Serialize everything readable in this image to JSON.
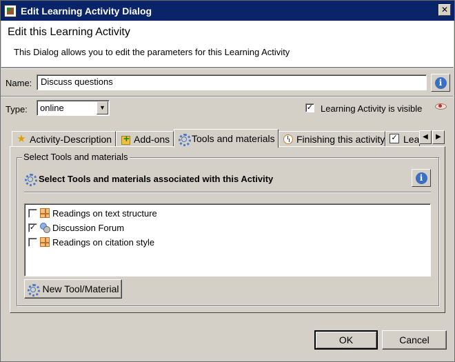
{
  "window": {
    "title": "Edit Learning Activity Dialog",
    "close_glyph": "✕"
  },
  "header": {
    "title": "Edit this Learning Activity",
    "description": "This Dialog allows you to edit the parameters for this Learning Activity"
  },
  "form": {
    "name_label": "Name:",
    "name_value": "Discuss questions",
    "type_label": "Type:",
    "type_value": "online",
    "visible_label": "Learning Activity is visible",
    "visible_checked": true,
    "info_glyph": "i"
  },
  "tabs": [
    {
      "label": "Activity-Description",
      "icon": "star-icon",
      "active": false
    },
    {
      "label": "Add-ons",
      "icon": "add-icon",
      "active": false
    },
    {
      "label": "Tools and materials",
      "icon": "gear-icon",
      "active": true
    },
    {
      "label": "Finishing this activity",
      "icon": "clock-icon",
      "active": false
    },
    {
      "label": "Lea",
      "icon": "checkbox-icon",
      "active": false
    }
  ],
  "tab_scroll": {
    "left_glyph": "◀",
    "right_glyph": "▶"
  },
  "tools_panel": {
    "group_label": "Select Tools and materials",
    "section_title": "Select Tools and materials associated with this Activity",
    "items": [
      {
        "label": "Readings on text structure",
        "checked": false,
        "icon": "grid-icon"
      },
      {
        "label": "Discussion Forum",
        "checked": true,
        "icon": "forum-icon"
      },
      {
        "label": "Readings on citation style",
        "checked": false,
        "icon": "grid-icon"
      }
    ],
    "new_button_label": "New Tool/Material"
  },
  "footer": {
    "ok_label": "OK",
    "cancel_label": "Cancel"
  },
  "colors": {
    "titlebar": "#0a246a",
    "dialog_bg": "#d4d0c8",
    "info_blue": "#3a6fc4"
  }
}
